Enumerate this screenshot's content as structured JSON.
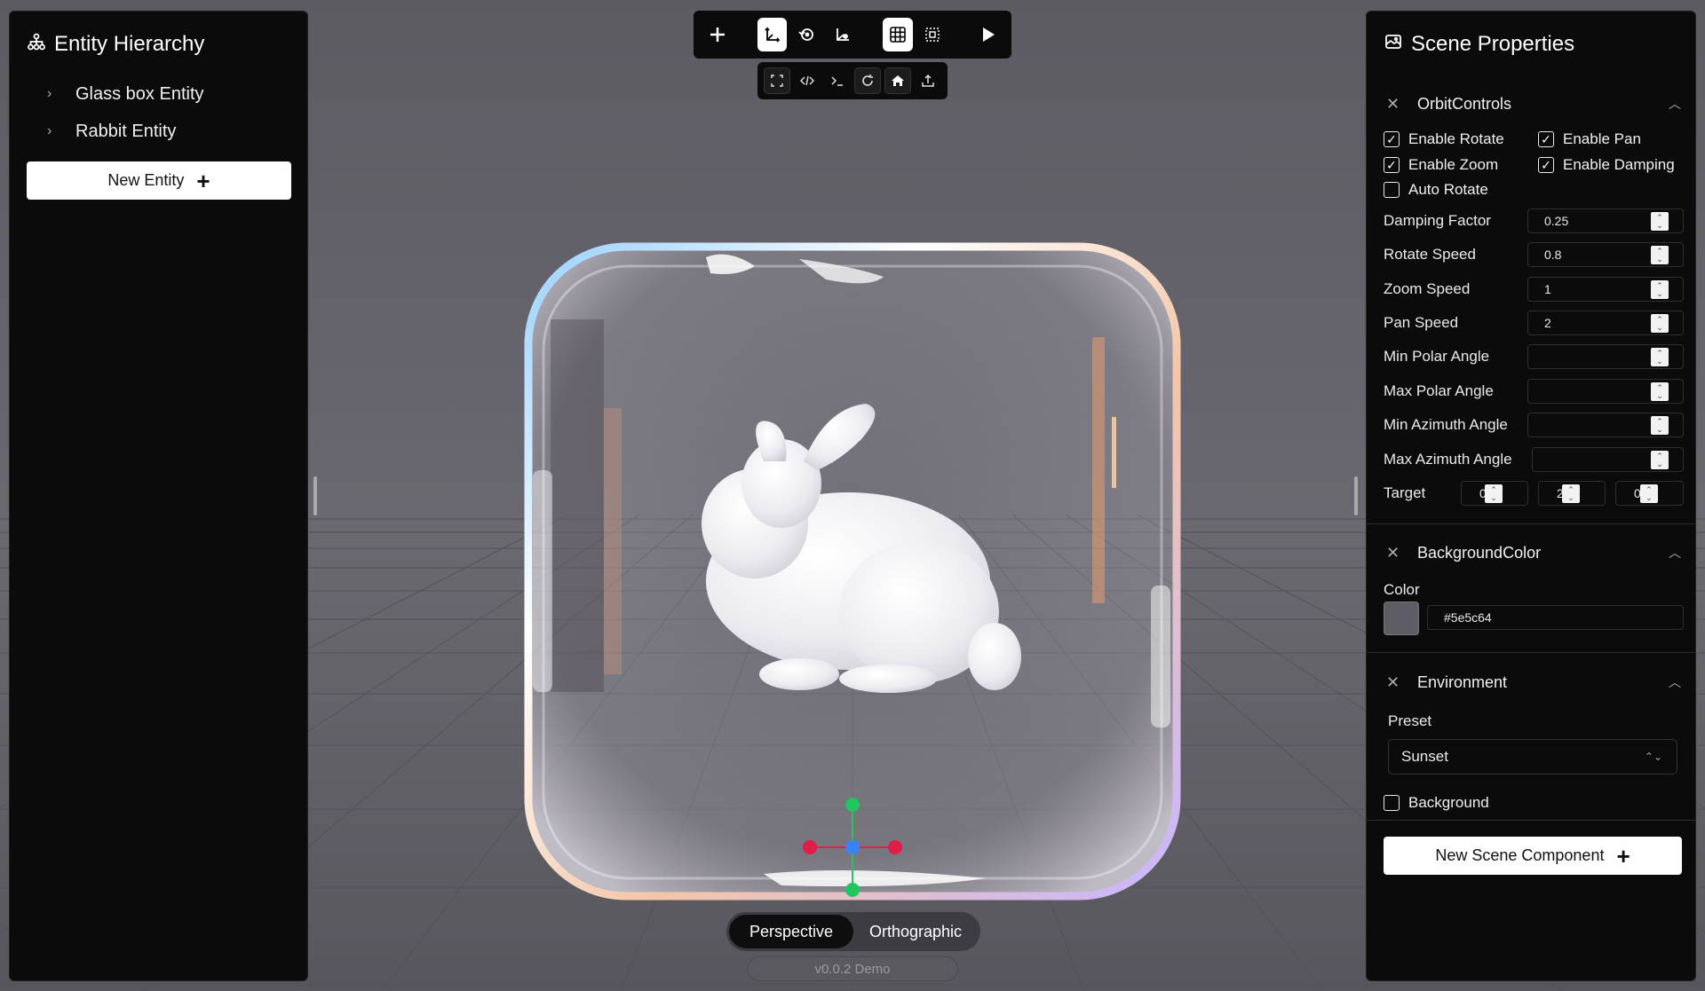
{
  "hierarchy": {
    "title": "Entity Hierarchy",
    "icon": "hierarchy-icon",
    "items": [
      {
        "label": "Glass box Entity",
        "icon": "chevron-right-icon"
      },
      {
        "label": "Rabbit Entity",
        "icon": "chevron-right-icon"
      }
    ],
    "new_entity_label": "New Entity"
  },
  "toolbar": {
    "main": [
      "add-icon",
      "translate-icon",
      "rotate-icon",
      "scale-icon",
      "grid-icon",
      "bounding-box-icon",
      "play-icon"
    ],
    "sub": [
      "fullscreen-icon",
      "code-icon",
      "terminal-icon",
      "refresh-icon",
      "home-icon",
      "export-icon"
    ]
  },
  "camera": {
    "perspective_label": "Perspective",
    "orthographic_label": "Orthographic",
    "active": "Perspective"
  },
  "version": "v0.0.2 Demo",
  "properties": {
    "title": "Scene Properties",
    "icon": "image-icon",
    "orbit": {
      "title": "OrbitControls",
      "checkboxes": {
        "enable_rotate": {
          "label": "Enable Rotate",
          "checked": true
        },
        "enable_pan": {
          "label": "Enable Pan",
          "checked": true
        },
        "enable_zoom": {
          "label": "Enable Zoom",
          "checked": true
        },
        "enable_damping": {
          "label": "Enable Damping",
          "checked": true
        },
        "auto_rotate": {
          "label": "Auto Rotate",
          "checked": false
        }
      },
      "fields": {
        "damping_factor": {
          "label": "Damping Factor",
          "value": "0.25"
        },
        "rotate_speed": {
          "label": "Rotate Speed",
          "value": "0.8"
        },
        "zoom_speed": {
          "label": "Zoom Speed",
          "value": "1"
        },
        "pan_speed": {
          "label": "Pan Speed",
          "value": "2"
        },
        "min_polar": {
          "label": "Min Polar Angle",
          "value": ""
        },
        "max_polar": {
          "label": "Max Polar Angle",
          "value": ""
        },
        "min_azimuth": {
          "label": "Min Azimuth Angle",
          "value": ""
        },
        "max_azimuth": {
          "label": "Max Azimuth Angle",
          "value": ""
        }
      },
      "target": {
        "label": "Target",
        "x": "0",
        "y": "2",
        "z": "0"
      }
    },
    "background": {
      "title": "BackgroundColor",
      "color_label": "Color",
      "color_value": "#5e5c64"
    },
    "environment": {
      "title": "Environment",
      "preset_label": "Preset",
      "preset_value": "Sunset",
      "background_label": "Background",
      "background_checked": false
    },
    "new_component_label": "New Scene Component"
  },
  "colors": {
    "viewport_bg": "#5e5c64",
    "panel_bg": "#0b0b0b",
    "gizmo_green": "#22c55e",
    "gizmo_red": "#e11d48",
    "gizmo_blue": "#3b82f6"
  }
}
